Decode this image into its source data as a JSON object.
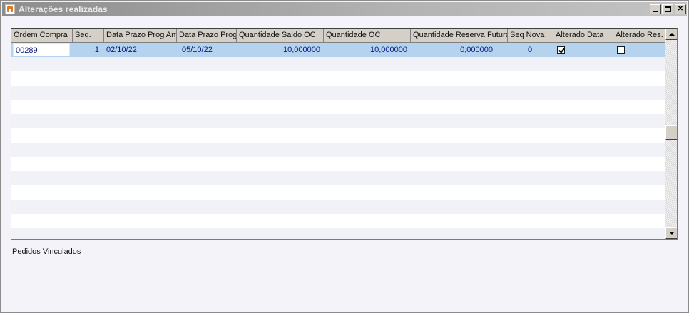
{
  "window": {
    "title": "Alterações realizadas"
  },
  "grid": {
    "columns": [
      "Ordem Compra",
      "Seq.",
      "Data Prazo Prog Ant",
      "Data Prazo Prog",
      "Quantidade Saldo OC",
      "Quantidade OC",
      "Quantidade Reserva Futura",
      "Seq Nova",
      "Alterado Data",
      "Alterado Res."
    ],
    "rows": [
      {
        "ordem_compra": "00289",
        "seq": "1",
        "data_prazo_prog_ant": "02/10/22",
        "data_prazo_prog": "05/10/22",
        "quantidade_saldo_oc": "10,000000",
        "quantidade_oc": "10,000000",
        "quantidade_reserva_futura": "0,000000",
        "seq_nova": "0",
        "alterado_data": true,
        "alterado_res": false
      }
    ]
  },
  "sections": {
    "pedidos_vinculados": "Pedidos Vinculados"
  },
  "colors": {
    "selected_row": "#b5d2ee",
    "alt_row": "#f0f2f8",
    "cell_text": "#0a1a7a",
    "header_bg": "#d4d0c8"
  }
}
